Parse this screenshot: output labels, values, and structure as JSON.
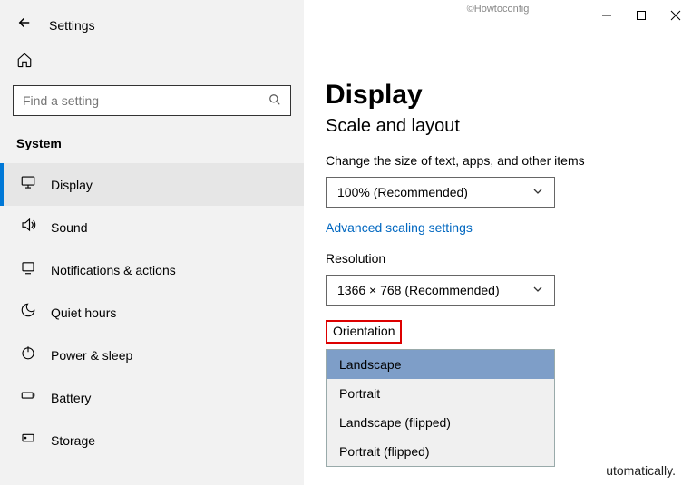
{
  "watermark": "©Howtoconfig",
  "app_title": "Settings",
  "search": {
    "placeholder": "Find a setting"
  },
  "category": "System",
  "nav": [
    {
      "icon": "monitor",
      "label": "Display",
      "active": true
    },
    {
      "icon": "sound",
      "label": "Sound"
    },
    {
      "icon": "notif",
      "label": "Notifications & actions"
    },
    {
      "icon": "moon",
      "label": "Quiet hours"
    },
    {
      "icon": "power",
      "label": "Power & sleep"
    },
    {
      "icon": "battery",
      "label": "Battery"
    },
    {
      "icon": "storage",
      "label": "Storage"
    }
  ],
  "page": {
    "title": "Display",
    "subtitle": "Scale and layout",
    "scale_label": "Change the size of text, apps, and other items",
    "scale_value": "100% (Recommended)",
    "adv_link": "Advanced scaling settings",
    "res_label": "Resolution",
    "res_value": "1366 × 768 (Recommended)",
    "orient_label": "Orientation",
    "orient_options": [
      "Landscape",
      "Portrait",
      "Landscape (flipped)",
      "Portrait (flipped)"
    ],
    "orient_selected": "Landscape",
    "trailing_text": "utomatically."
  }
}
